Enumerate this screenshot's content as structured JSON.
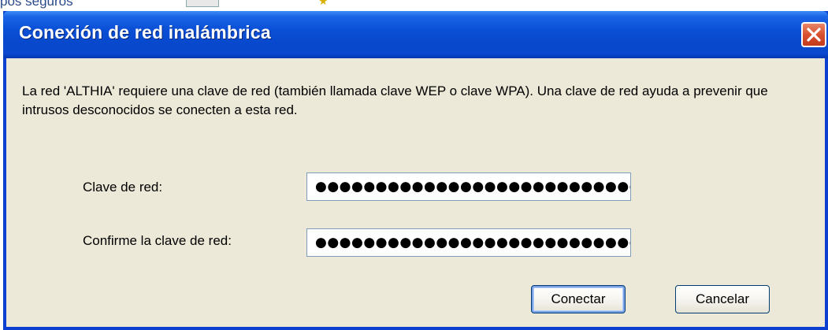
{
  "background_window": {
    "partial_text": "pos seguros"
  },
  "dialog": {
    "title": "Conexión de red inalámbrica",
    "description": "La red 'ALTHIA' requiere una clave de red (también llamada clave WEP o clave WPA). Una clave de red ayuda a prevenir que intrusos desconocidos se conecten a esta red.",
    "fields": {
      "network_key_label": "Clave de red:",
      "network_key_value": "●●●●●●●●●●●●●●●●●●●●●●●●●●●",
      "confirm_key_label": "Confirme la clave de red:",
      "confirm_key_value": "●●●●●●●●●●●●●●●●●●●●●●●●●●●"
    },
    "buttons": {
      "connect": "Conectar",
      "cancel": "Cancelar"
    },
    "colors": {
      "titlebar": "#0a4fd6",
      "client_bg": "#ece9d8",
      "close_button": "#d8512f"
    }
  }
}
